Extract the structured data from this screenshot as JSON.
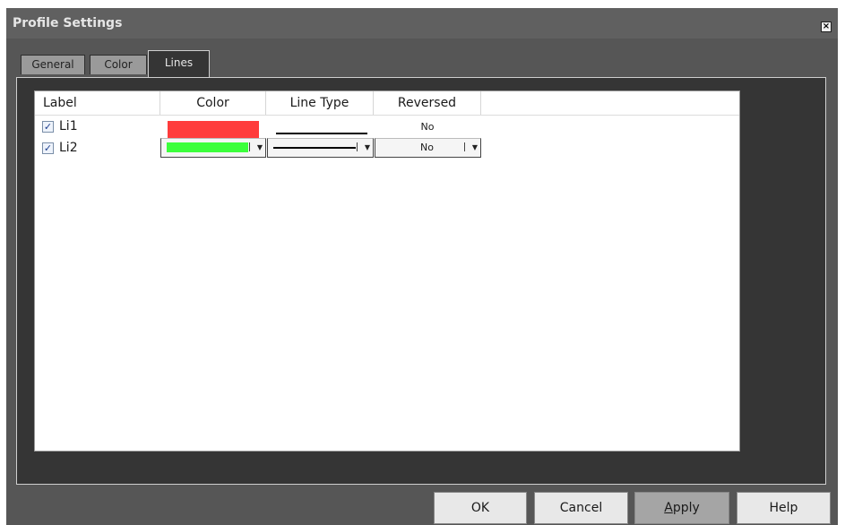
{
  "window": {
    "title": "Profile Settings",
    "close_glyph": "×"
  },
  "tabs": [
    {
      "label": "General"
    },
    {
      "label": "Color"
    },
    {
      "label": "Lines",
      "active": true
    }
  ],
  "grid": {
    "columns": [
      "Label",
      "Color",
      "Line Type",
      "Reversed"
    ],
    "rows": [
      {
        "checked": true,
        "label": "Li1",
        "color": "#ff3c3c",
        "line_type": "solid",
        "reversed": "No"
      },
      {
        "checked": true,
        "label": "Li2",
        "color": "#3cff3c",
        "line_type": "solid",
        "reversed": "No",
        "editing": true
      }
    ]
  },
  "buttons": {
    "ok": "OK",
    "cancel": "Cancel",
    "apply_mnemonic": "A",
    "apply_rest": "pply",
    "help": "Help"
  },
  "glyphs": {
    "check": "✓",
    "dropdown_arrow": "▼"
  },
  "colors": {
    "dialog_bg": "#565656",
    "panel_bg": "#353535",
    "li1_color": "#ff3c3c",
    "li2_color": "#3cff3c"
  }
}
